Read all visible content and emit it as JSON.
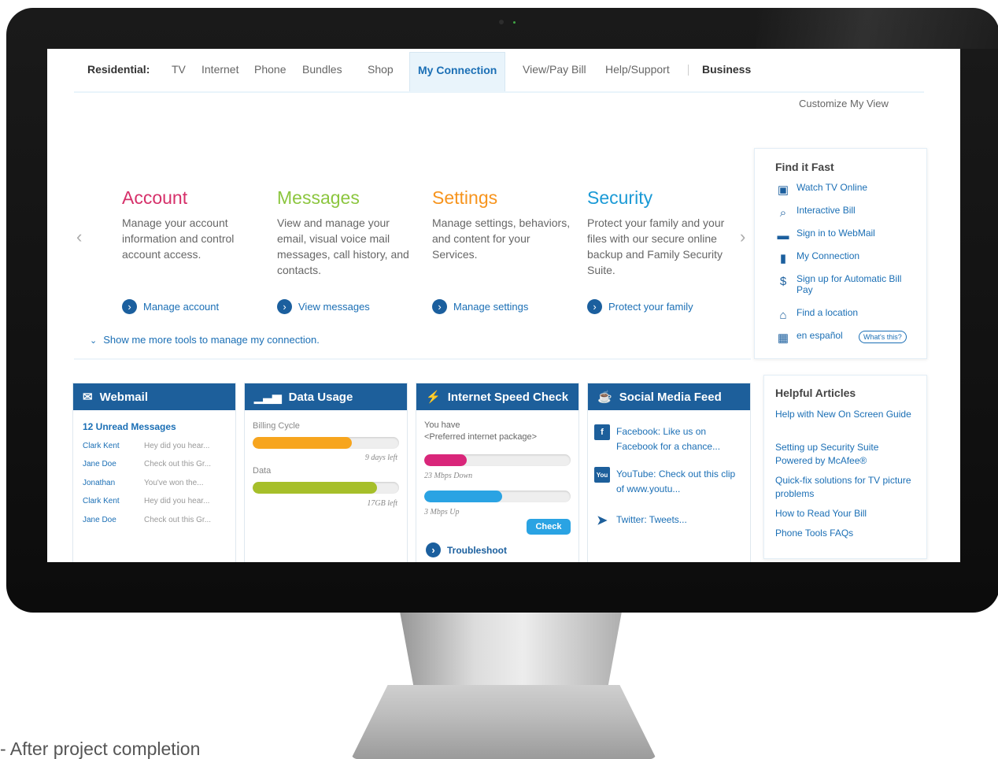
{
  "caption": "- After project completion",
  "nav": {
    "residential": "Residential:",
    "items": [
      "TV",
      "Internet",
      "Phone",
      "Bundles",
      "Shop"
    ],
    "active": "My Connection",
    "items_right": [
      "View/Pay Bill",
      "Help/Support"
    ],
    "business": "Business",
    "customize": "Customize My View"
  },
  "carousel": {
    "prev": "‹",
    "next": "›",
    "columns": [
      {
        "title": "Account",
        "text": "Manage your account information and control account access.",
        "link": "Manage account",
        "color": "#d6306a"
      },
      {
        "title": "Messages",
        "text": "View and manage your email, visual voice mail messages, call history, and contacts.",
        "link": "View messages",
        "color": "#8cc63f"
      },
      {
        "title": "Settings",
        "text": "Manage settings, behaviors, and content for your Services.",
        "link": "Manage settings",
        "color": "#f7941d"
      },
      {
        "title": "Security",
        "text": "Protect your family and your files with our secure online backup and Family Security Suite.",
        "link": "Protect your family",
        "color": "#1b9ad6"
      }
    ],
    "show_more": "Show me more tools to manage my connection."
  },
  "find_it_fast": {
    "title": "Find it Fast",
    "items": [
      {
        "label": "Watch TV Online",
        "icon": "tv-icon"
      },
      {
        "label": "Interactive Bill",
        "icon": "bill-magnifier-icon"
      },
      {
        "label": "Sign in to WebMail",
        "icon": "computer-icon"
      },
      {
        "label": "My Connection",
        "icon": "phone-icon"
      },
      {
        "label": "Sign up for Automatic Bill Pay",
        "icon": "dollar-icon"
      },
      {
        "label": "Find a location",
        "icon": "location-icon"
      },
      {
        "label": "en español",
        "icon": "store-icon"
      }
    ],
    "whats_this": "What's this?"
  },
  "webmail": {
    "title": "Webmail",
    "unread": "12 Unread Messages",
    "messages": [
      {
        "sender": "Clark Kent",
        "preview": "Hey did you hear..."
      },
      {
        "sender": "Jane Doe",
        "preview": "Check out this Gr..."
      },
      {
        "sender": "Jonathan",
        "preview": "You've won the..."
      },
      {
        "sender": "Clark Kent",
        "preview": "Hey did you hear..."
      },
      {
        "sender": "Jane Doe",
        "preview": "Check out this Gr..."
      }
    ]
  },
  "data_usage": {
    "title": "Data Usage",
    "billing_label": "Billing Cycle",
    "billing_note": "9 days left",
    "billing_fraction": 0.68,
    "billing_color": "#f7a51e",
    "data_label": "Data",
    "data_note": "17GB left",
    "data_fraction": 0.85,
    "data_color": "#a6bf2a"
  },
  "speed_check": {
    "title": "Internet Speed Check",
    "text_line1": "You have",
    "text_line2": "<Preferred internet package>",
    "down_note": "23 Mbps Down",
    "down_fraction": 0.29,
    "down_color": "#d9267a",
    "up_note": "3 Mbps Up",
    "up_fraction": 0.53,
    "up_color": "#2aa3e3",
    "check_label": "Check",
    "troubleshoot_label": "Troubleshoot"
  },
  "social": {
    "title": "Social Media Feed",
    "items": [
      {
        "text": "Facebook: Like us on Facebook for a chance...",
        "icon": "facebook-icon",
        "glyph": "f"
      },
      {
        "text": "YouTube: Check out this clip of www.youtu...",
        "icon": "youtube-icon",
        "glyph": "You"
      },
      {
        "text": "Twitter: Tweets...",
        "icon": "twitter-icon",
        "glyph": ""
      }
    ]
  },
  "helpful": {
    "title": "Helpful Articles",
    "items": [
      "Help with New On Screen Guide",
      "Setting up Security Suite Powered by McAfee®",
      "Quick-fix solutions for TV picture problems",
      "How to Read Your Bill",
      "Phone Tools FAQs"
    ]
  }
}
